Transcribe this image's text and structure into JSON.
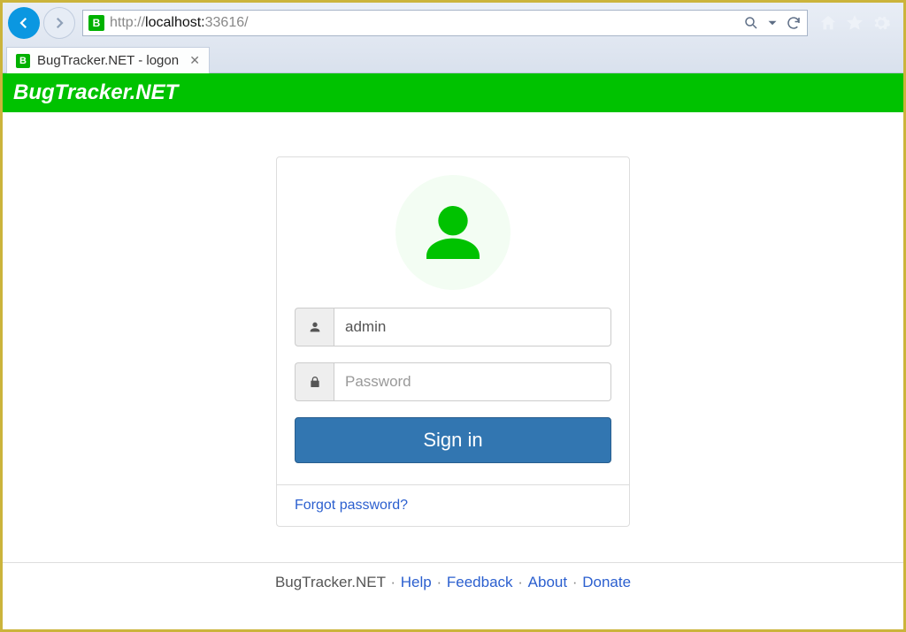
{
  "browser": {
    "url_prefix": "http://",
    "url_host": "localhost:",
    "url_port": "33616/",
    "tab_title": "BugTracker.NET - logon"
  },
  "brand": {
    "title": "BugTracker.NET"
  },
  "login": {
    "username_value": "admin",
    "password_placeholder": "Password",
    "signin_label": "Sign in",
    "forgot_label": "Forgot password?"
  },
  "footer": {
    "product": "BugTracker.NET",
    "links": {
      "help": "Help",
      "feedback": "Feedback",
      "about": "About",
      "donate": "Donate"
    }
  }
}
